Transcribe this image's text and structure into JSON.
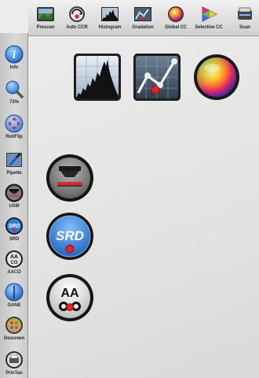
{
  "toolbar": {
    "items": [
      {
        "label": "Prescan",
        "icon": "prescan-icon"
      },
      {
        "label": "Auto CCR",
        "icon": "auto-ccr-icon"
      },
      {
        "label": "Histogram",
        "icon": "histogram-icon"
      },
      {
        "label": "Gradation",
        "icon": "gradation-icon"
      },
      {
        "label": "Global CC",
        "icon": "global-cc-icon"
      },
      {
        "label": "Selective CC",
        "icon": "selective-cc-icon"
      },
      {
        "label": "Scan",
        "icon": "scan-icon"
      }
    ]
  },
  "sidebar": {
    "items": [
      {
        "label": "Info",
        "icon": "info-icon"
      },
      {
        "label": "73%",
        "icon": "zoom-icon"
      },
      {
        "label": "Rot/Flip",
        "icon": "rotate-flip-icon"
      },
      {
        "label": "Pipette",
        "icon": "pipette-icon"
      },
      {
        "label": "USM",
        "icon": "usm-icon"
      },
      {
        "label": "SRD",
        "icon": "srd-icon"
      },
      {
        "label": "AACO",
        "icon": "aaco-icon"
      },
      {
        "label": "GANE",
        "icon": "gane-icon"
      },
      {
        "label": "Descreen",
        "icon": "descreen-icon"
      },
      {
        "label": "PrinTao",
        "icon": "printao-icon"
      }
    ]
  },
  "main": {
    "buttons": [
      {
        "name": "histogram-button",
        "icon": "histogram-icon"
      },
      {
        "name": "gradation-button",
        "icon": "gradation-icon"
      },
      {
        "name": "global-cc-button",
        "icon": "color-wheel-icon"
      },
      {
        "name": "usm-button",
        "icon": "usm-icon"
      },
      {
        "name": "srd-button",
        "icon": "srd-icon",
        "text": "SRD"
      },
      {
        "name": "aaco-button",
        "icon": "aaco-icon",
        "text_top": "AA",
        "text_bottom": "CO"
      }
    ]
  },
  "colors": {
    "accent_blue": "#2f7fd3",
    "red_dot": "#e0262a",
    "toolbar_bg": "#dcdcdc",
    "sidebar_bg": "#d2d2d2",
    "canvas_bg": "#e6e6e5"
  }
}
